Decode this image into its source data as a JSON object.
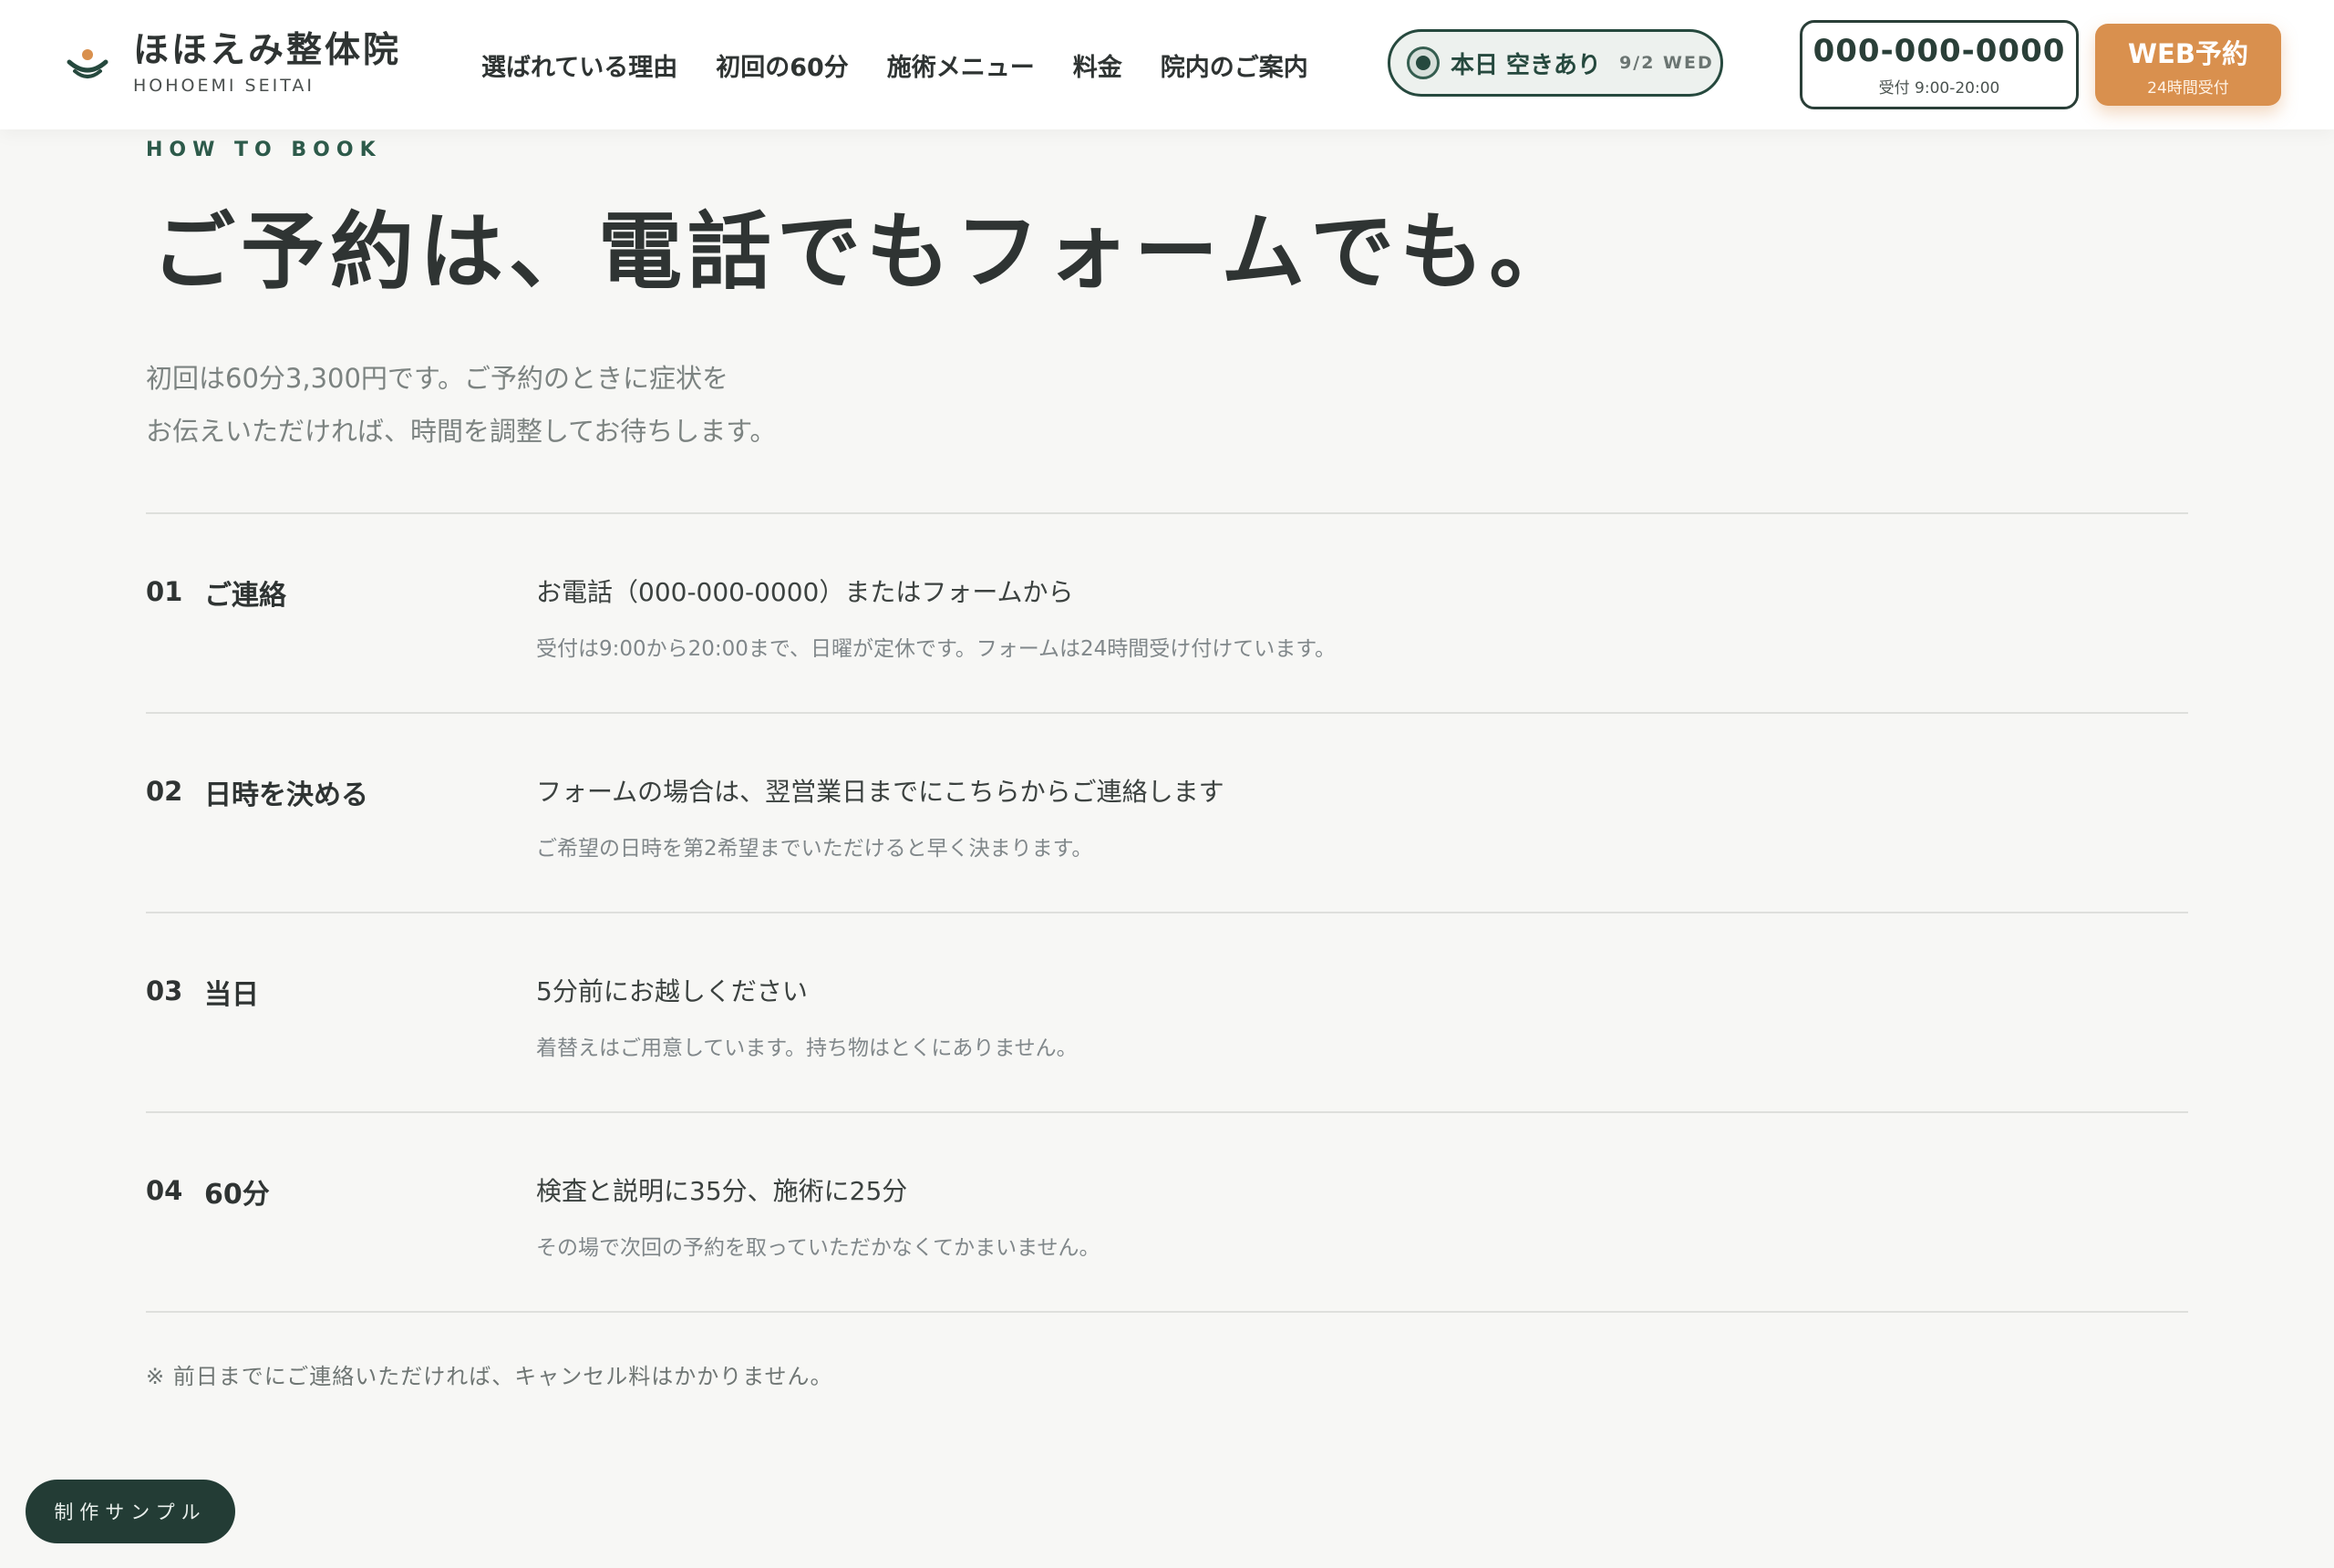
{
  "brand": {
    "name": "ほほえみ整体院",
    "roman": "HOHOEMI SEITAI",
    "logo_icon": "smile-sun-icon",
    "colors": {
      "green": "#26493e",
      "orange": "#d9904e"
    }
  },
  "nav": {
    "items": [
      {
        "label": "選ばれている理由"
      },
      {
        "label": "初回の60分"
      },
      {
        "label": "施術メニュー"
      },
      {
        "label": "料金"
      },
      {
        "label": "院内のご案内"
      }
    ]
  },
  "availability": {
    "text": "本日 空きあり",
    "date": "9/2 WED"
  },
  "phone": {
    "number": "000-000-0000",
    "hours": "受付 9:00-20:00"
  },
  "web_booking": {
    "label": "WEB予約",
    "sub": "24時間受付"
  },
  "section": {
    "eyebrow": "HOW TO BOOK",
    "title": "ご予約は、電話でもフォームでも。",
    "lead": [
      "初回は60分3,300円です。ご予約のときに症状を",
      "お伝えいただければ、時間を調整してお待ちします。"
    ]
  },
  "steps": [
    {
      "num": "01",
      "title": "ご連絡",
      "main": "お電話（000-000-0000）またはフォームから",
      "sub": "受付は9:00から20:00まで、日曜が定休です。フォームは24時間受け付けています。"
    },
    {
      "num": "02",
      "title": "日時を決める",
      "main": "フォームの場合は、翌営業日までにこちらからご連絡します",
      "sub": "ご希望の日時を第2希望までいただけると早く決まります。"
    },
    {
      "num": "03",
      "title": "当日",
      "main": "5分前にお越しください",
      "sub": "着替えはご用意しています。持ち物はとくにありません。"
    },
    {
      "num": "04",
      "title": "60分",
      "main": "検査と説明に35分、施術に25分",
      "sub": "その場で次回の予約を取っていただかなくてかまいません。"
    }
  ],
  "note": "※ 前日までにご連絡いただければ、キャンセル料はかかりません。",
  "sample_badge": "制作サンプル"
}
